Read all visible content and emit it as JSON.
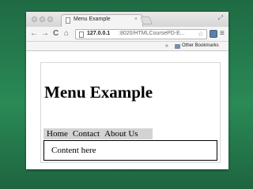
{
  "browser": {
    "tab": {
      "title": "Menu Example",
      "close": "×"
    },
    "nav": {
      "back": "←",
      "forward": "→",
      "reload": "C",
      "home": "⌂"
    },
    "address": {
      "host": "127.0.0.1",
      "path": ":8020/HTMLCoursePD-E..."
    },
    "bookmarks_bar": {
      "overflow": "»",
      "item": "Other Bookmarks"
    },
    "menu_icon": "≡"
  },
  "page": {
    "heading": "Menu Example",
    "menu": [
      {
        "label": "Home"
      },
      {
        "label": "Contact"
      },
      {
        "label": "About Us"
      }
    ],
    "content": "Content here"
  },
  "colors": {
    "background": "#237a4c",
    "menu_bar": "#d3d3d3"
  }
}
